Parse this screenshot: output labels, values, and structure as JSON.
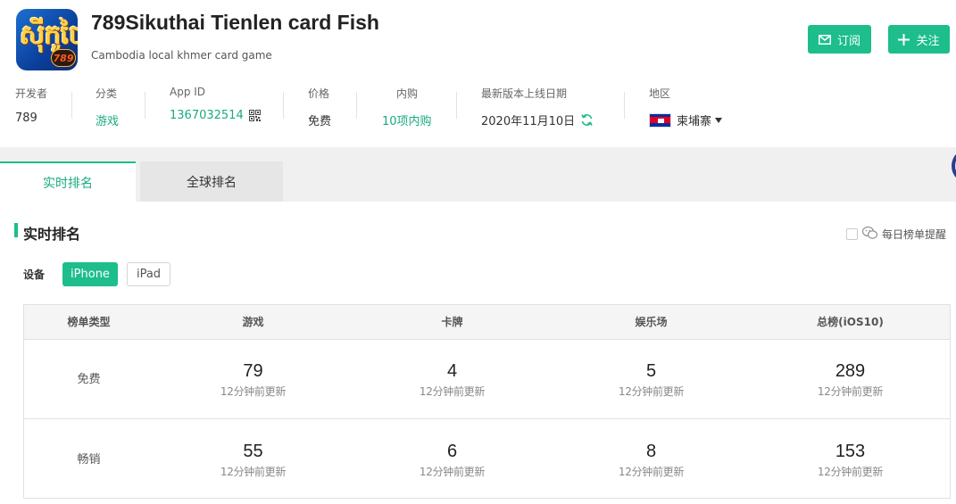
{
  "app": {
    "icon_text": "ស៊ីកូថៃ",
    "icon_badge": "789",
    "title": "789Sikuthai Tienlen card Fish",
    "subtitle": "Cambodia local khmer card game"
  },
  "header_buttons": {
    "subscribe": "订阅",
    "follow": "关注"
  },
  "info": {
    "developer": {
      "label": "开发者",
      "value": "789"
    },
    "category": {
      "label": "分类",
      "value": "游戏"
    },
    "app_id": {
      "label": "App ID",
      "value": "1367032514"
    },
    "price": {
      "label": "价格",
      "value": "免费"
    },
    "iap": {
      "label": "内购",
      "value": "10项内购"
    },
    "release": {
      "label": "最新版本上线日期",
      "value": "2020年11月10日"
    },
    "region": {
      "label": "地区",
      "value": "柬埔寨"
    }
  },
  "tabs": [
    {
      "label": "实时排名",
      "active": true
    },
    {
      "label": "全球排名",
      "active": false
    }
  ],
  "section": {
    "title": "实时排名",
    "daily_reminder": "每日榜单提醒",
    "device_label": "设备",
    "devices": [
      "iPhone",
      "iPad"
    ],
    "selected_device": "iPhone"
  },
  "table": {
    "headers": [
      "榜单类型",
      "游戏",
      "卡牌",
      "娱乐场",
      "总榜(iOS10)"
    ],
    "rows": [
      {
        "label": "免费",
        "cells": [
          {
            "rank": "79",
            "updated": "12分钟前更新"
          },
          {
            "rank": "4",
            "updated": "12分钟前更新"
          },
          {
            "rank": "5",
            "updated": "12分钟前更新"
          },
          {
            "rank": "289",
            "updated": "12分钟前更新"
          }
        ]
      },
      {
        "label": "畅销",
        "cells": [
          {
            "rank": "55",
            "updated": "12分钟前更新"
          },
          {
            "rank": "6",
            "updated": "12分钟前更新"
          },
          {
            "rank": "8",
            "updated": "12分钟前更新"
          },
          {
            "rank": "153",
            "updated": "12分钟前更新"
          }
        ]
      }
    ]
  },
  "colors": {
    "accent": "#1dbd8c",
    "accent_text": "#1aa982"
  },
  "icons": [
    "mail-icon",
    "plus-icon",
    "qr-code-icon",
    "refresh-icon",
    "cambodia-flag-icon",
    "chevron-down-icon",
    "wechat-icon"
  ]
}
